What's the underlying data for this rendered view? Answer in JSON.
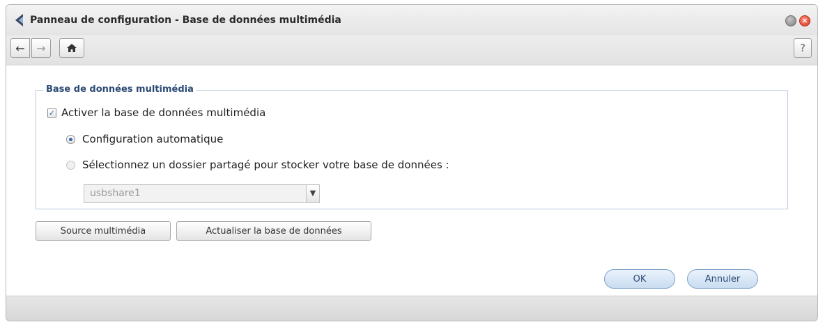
{
  "window": {
    "title": "Panneau de configuration - Base de données multimédia"
  },
  "toolbar": {
    "back_icon": "arrow-left-icon",
    "forward_icon": "arrow-right-icon",
    "home_icon": "home-icon",
    "help_label": "?"
  },
  "section": {
    "legend": "Base de données multimédia",
    "enable_label": "Activer la base de données multimédia",
    "enable_checked": true,
    "radio_auto_label": "Configuration automatique",
    "radio_auto_checked": true,
    "radio_shared_label": "Sélectionnez un dossier partagé pour stocker votre base de données :",
    "radio_shared_checked": false,
    "shared_folder_value": "usbshare1"
  },
  "actions": {
    "source_label": "Source multimédia",
    "refresh_label": "Actualiser la base de données",
    "ok_label": "OK",
    "cancel_label": "Annuler"
  },
  "colors": {
    "accent": "#3a62b3",
    "legend": "#2b4a74",
    "close": "#d43a22"
  }
}
